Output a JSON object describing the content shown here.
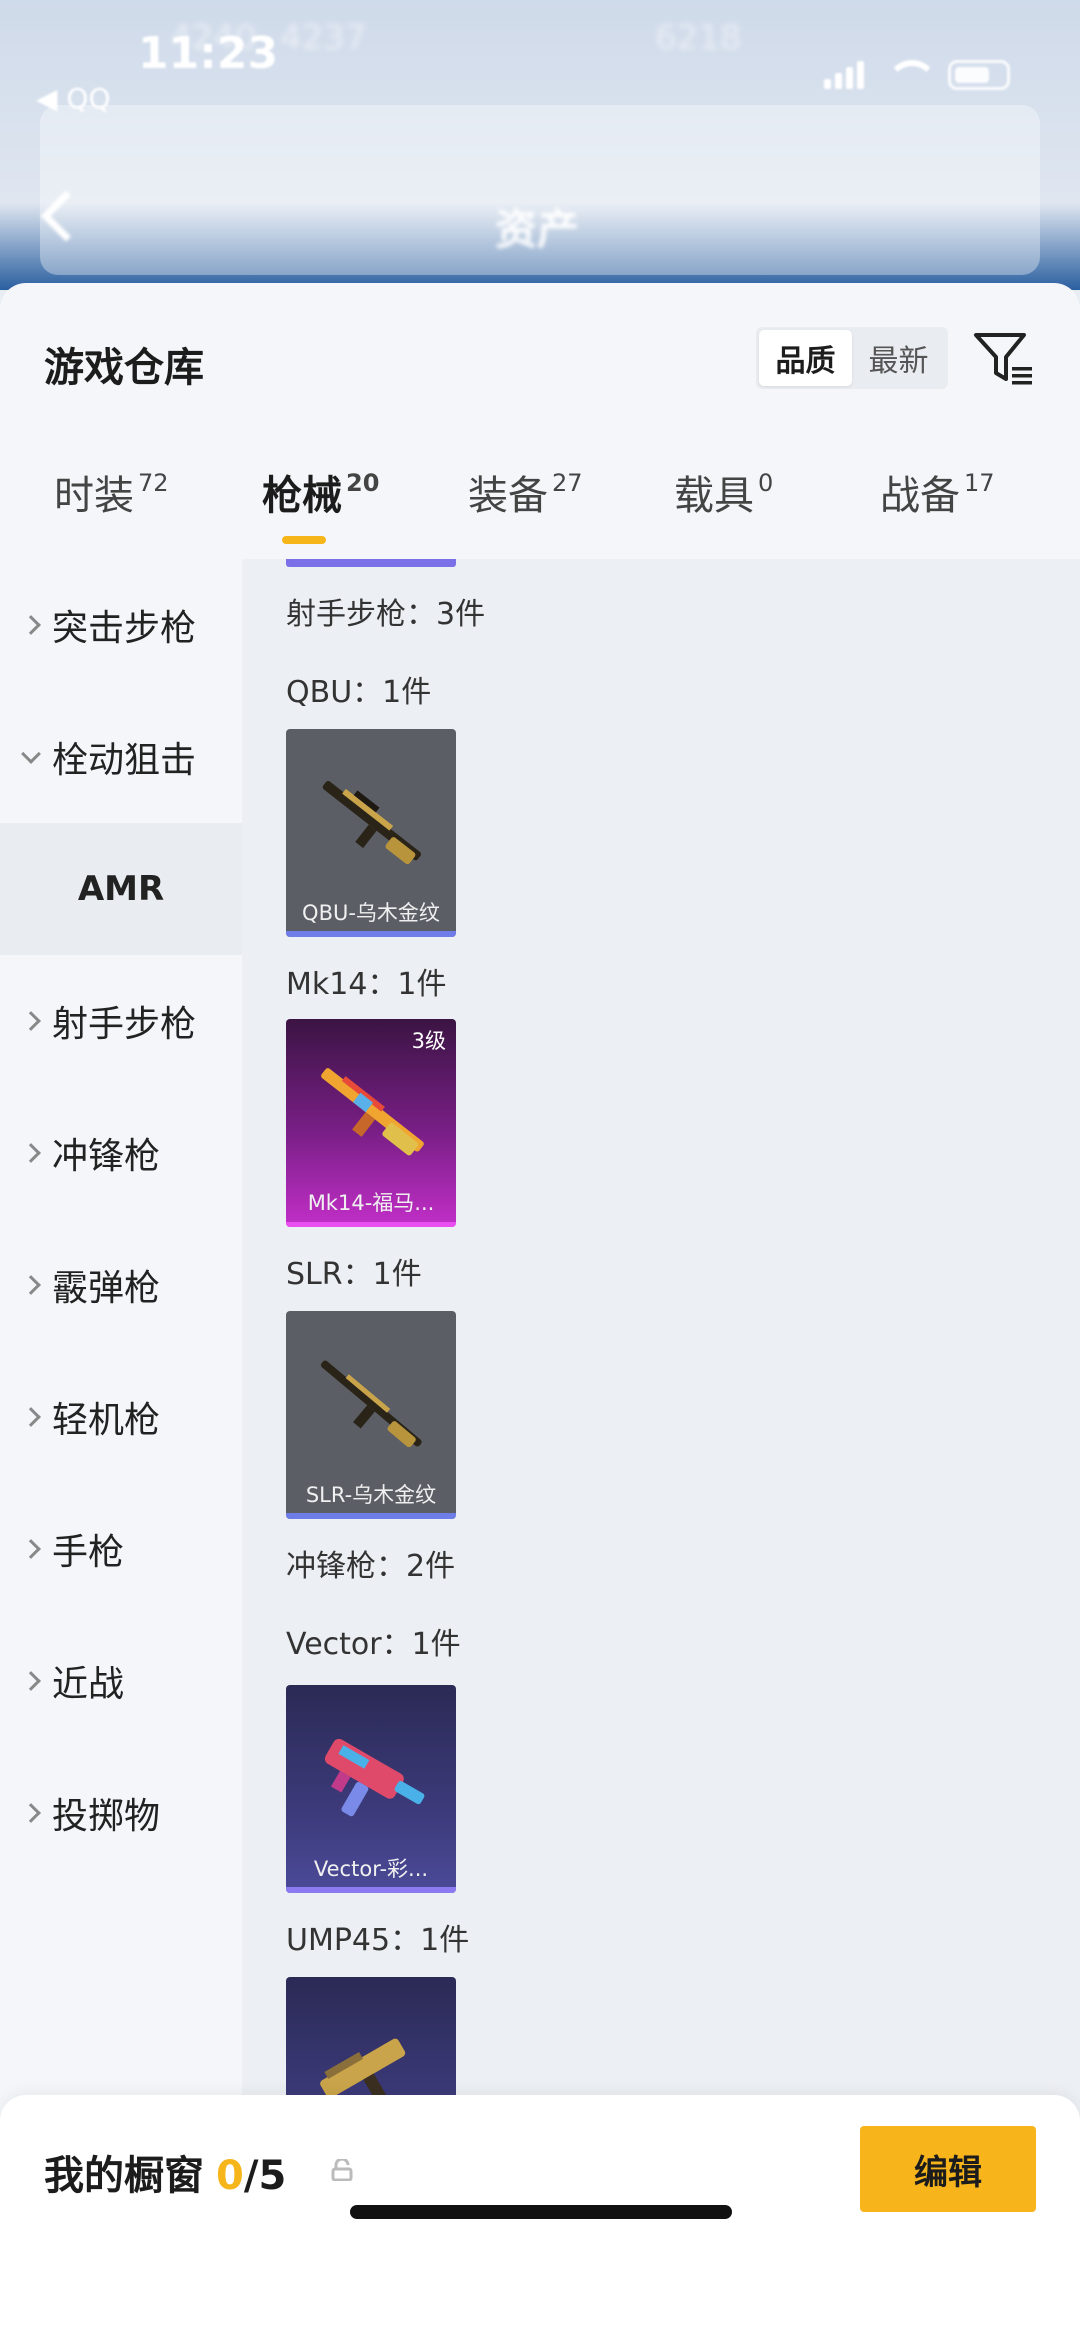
{
  "status": {
    "time": "11:23",
    "back_app": "◀ QQ"
  },
  "header": {
    "title": "资产"
  },
  "sheet": {
    "title": "游戏仓库",
    "sort": {
      "quality": "品质",
      "latest": "最新"
    }
  },
  "tabs": [
    {
      "label": "时装",
      "count": "72"
    },
    {
      "label": "枪械",
      "count": "20"
    },
    {
      "label": "装备",
      "count": "27"
    },
    {
      "label": "载具",
      "count": "0"
    },
    {
      "label": "战备",
      "count": "17"
    }
  ],
  "sidebar": [
    {
      "label": "突击步枪"
    },
    {
      "label": "栓动狙击"
    },
    {
      "label": "AMR"
    },
    {
      "label": "射手步枪"
    },
    {
      "label": "冲锋枪"
    },
    {
      "label": "霰弹枪"
    },
    {
      "label": "轻机枪"
    },
    {
      "label": "手枪"
    },
    {
      "label": "近战"
    },
    {
      "label": "投掷物"
    }
  ],
  "content": {
    "groups": [
      {
        "label": "射手步枪：3件"
      },
      {
        "label": "冲锋枪：2件"
      }
    ],
    "subgroups": [
      {
        "label": "QBU：1件"
      },
      {
        "label": "Mk14：1件"
      },
      {
        "label": "SLR：1件"
      },
      {
        "label": "Vector：1件"
      },
      {
        "label": "UMP45：1件"
      }
    ],
    "cards": [
      {
        "name": "QBU-乌木金纹"
      },
      {
        "name": "Mk14-福马...",
        "level": "3级"
      },
      {
        "name": "SLR-乌木金纹"
      },
      {
        "name": "Vector-彩..."
      }
    ]
  },
  "bottom": {
    "showcase_label": "我的橱窗",
    "showcase_count": "0",
    "showcase_total": "/5",
    "edit": "编辑"
  }
}
